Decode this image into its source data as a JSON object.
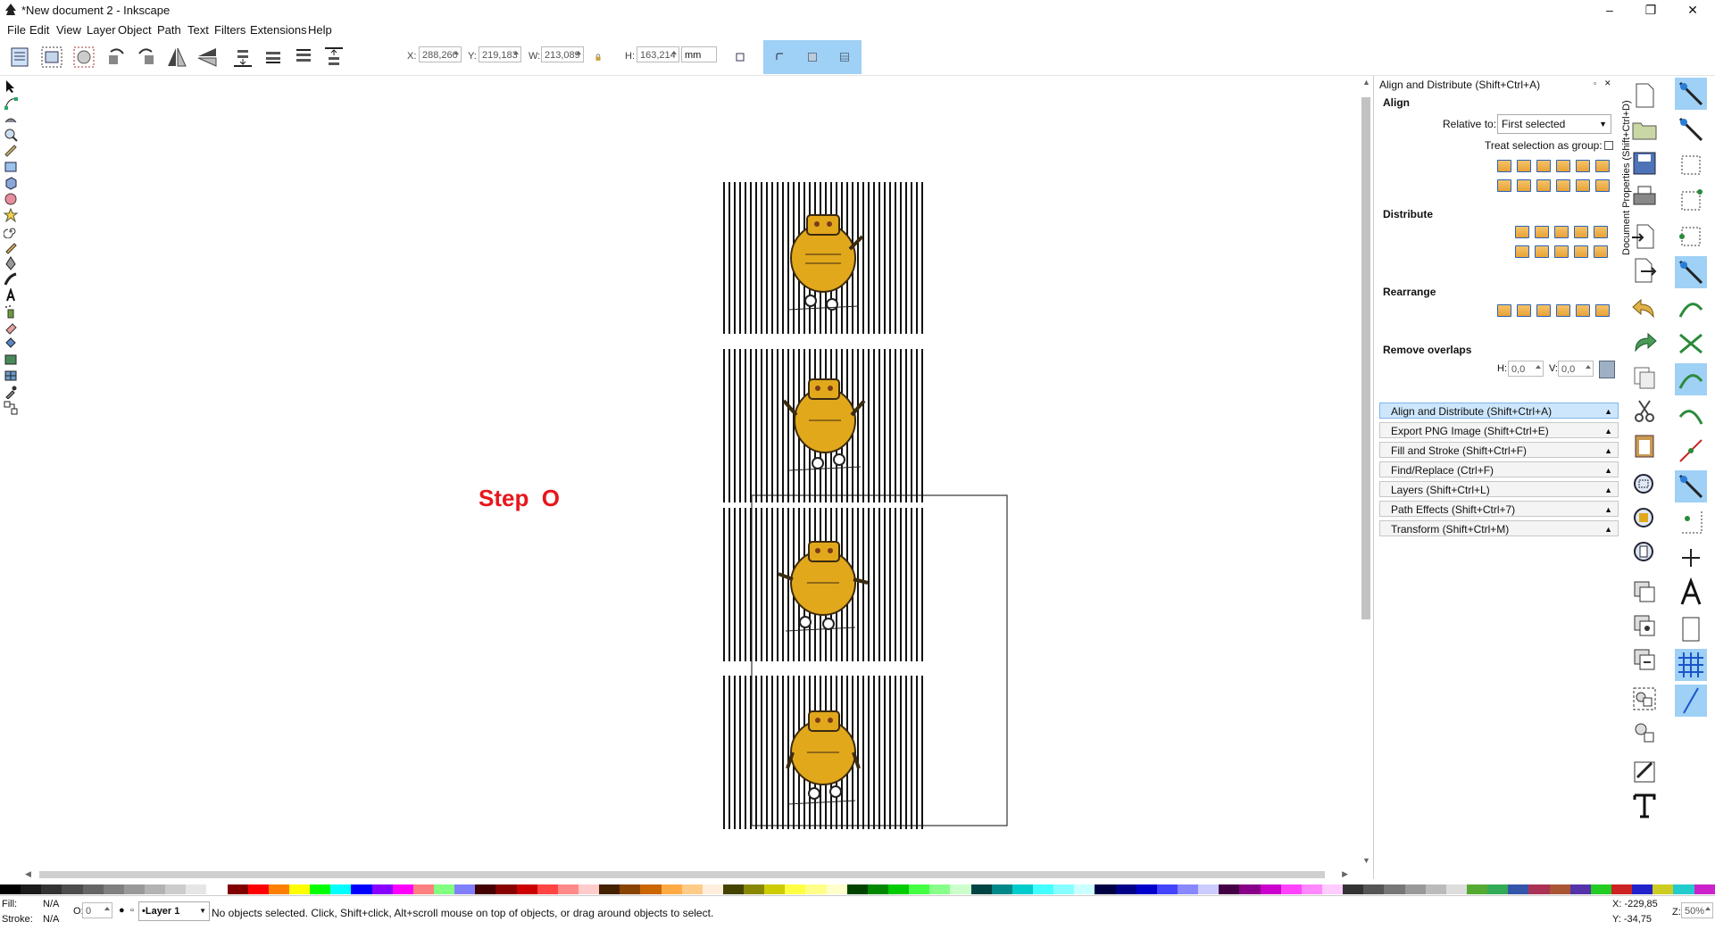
{
  "window": {
    "title": "*New document 2 - Inkscape",
    "minimize": "–",
    "restore": "❐",
    "close": "✕"
  },
  "menu": [
    "File",
    "Edit",
    "View",
    "Layer",
    "Object",
    "Path",
    "Text",
    "Filters",
    "Extensions",
    "Help"
  ],
  "toolbar": {
    "x_label": "X:",
    "x_value": "288,260",
    "y_label": "Y:",
    "y_value": "219,183",
    "w_label": "W:",
    "w_value": "213,089",
    "h_label": "H:",
    "h_value": "163,214",
    "unit": "mm"
  },
  "canvas": {
    "step_text": "Step  O",
    "step_color": "#e8161b"
  },
  "dock": {
    "title": "Align and Distribute (Shift+Ctrl+A)",
    "align_heading": "Align",
    "relative_label": "Relative to:",
    "relative_value": "First selected",
    "treat_group_label": "Treat selection as group:",
    "distribute_heading": "Distribute",
    "rearrange_heading": "Rearrange",
    "remove_overlaps_heading": "Remove overlaps",
    "h_label": "H:",
    "h_value": "0,0",
    "v_label": "V:",
    "v_value": "0,0",
    "side_tab": "Document Properties (Shift+Ctrl+D)",
    "dialogs": [
      "Align and Distribute (Shift+Ctrl+A)",
      "Export PNG Image (Shift+Ctrl+E)",
      "Fill and Stroke (Shift+Ctrl+F)",
      "Find/Replace (Ctrl+F)",
      "Layers (Shift+Ctrl+L)",
      "Path Effects  (Shift+Ctrl+7)",
      "Transform (Shift+Ctrl+M)"
    ]
  },
  "status": {
    "fill_label": "Fill:",
    "fill_value": "N/A",
    "stroke_label": "Stroke:",
    "stroke_value": "N/A",
    "opacity_label": "O:",
    "opacity_value": "0",
    "layer": "•Layer 1",
    "message": "No objects selected. Click, Shift+click, Alt+scroll mouse on top of objects, or drag around objects to select.",
    "cursor_x": "X: -229,85",
    "cursor_y": "Y:  -34,75",
    "zoom_label": "Z:",
    "zoom_value": "50%"
  },
  "colors": {
    "accent": "#9fd0f5",
    "robot_body": "#e2a81c",
    "robot_outline": "#3a2a10"
  }
}
